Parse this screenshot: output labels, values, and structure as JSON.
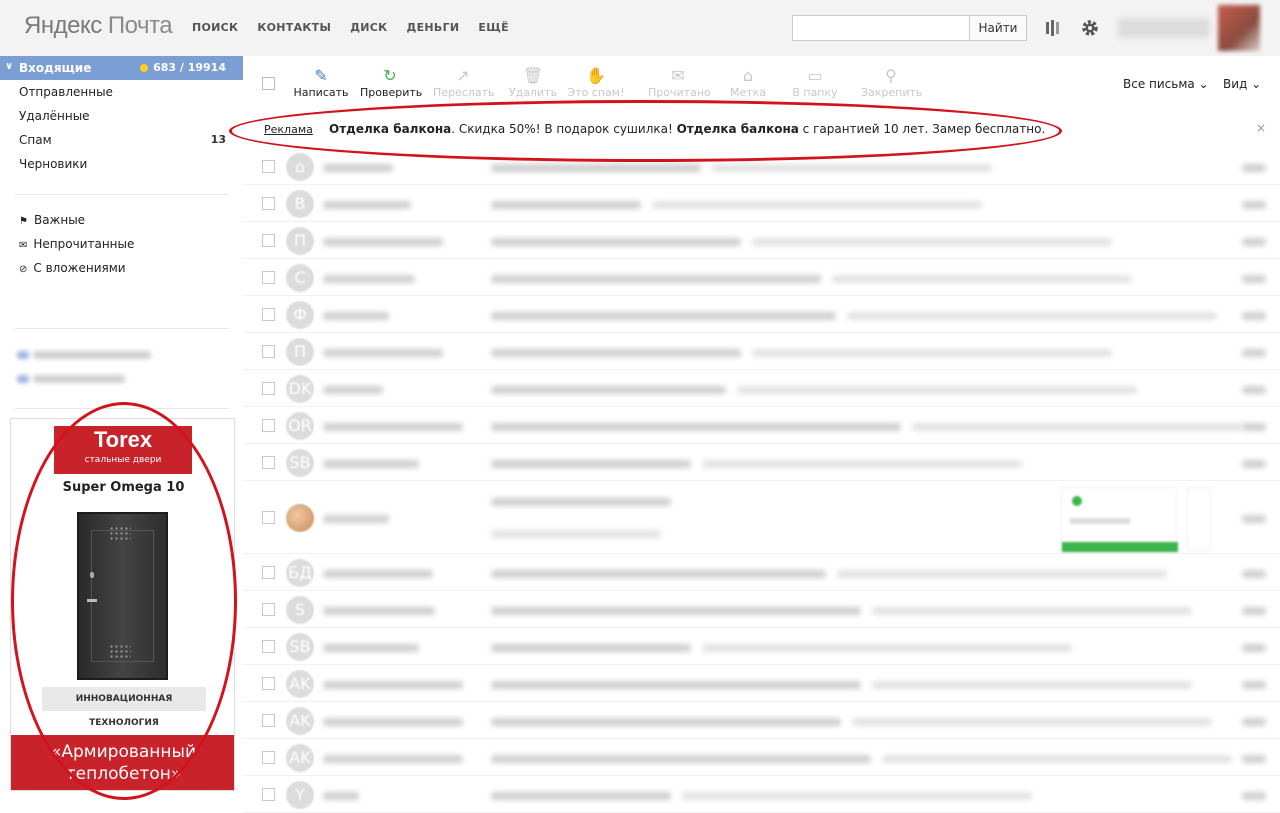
{
  "header": {
    "logo_yandex": "Яндекс",
    "logo_mail": "Почта",
    "nav": [
      "ПОИСК",
      "КОНТАКТЫ",
      "ДИСК",
      "ДЕНЬГИ",
      "ЕЩЁ"
    ],
    "search_button": "Найти"
  },
  "sidebar": {
    "inbox_label": "Входящие",
    "inbox_count": "683 / 19914",
    "folders": [
      {
        "label": "Отправленные",
        "count": ""
      },
      {
        "label": "Удалённые",
        "count": ""
      },
      {
        "label": "Спам",
        "count": "13"
      },
      {
        "label": "Черновики",
        "count": ""
      }
    ],
    "filters": [
      "Важные",
      "Непрочитанные",
      "С вложениями"
    ]
  },
  "side_ad": {
    "brand": "Torex",
    "brand_sub": "стальные двери",
    "model": "Super Omega 10",
    "tagline": "ИННОВАЦИОННАЯ ТЕХНОЛОГИЯ",
    "bottom_line1": "«Армированный",
    "bottom_line2": "теплобетон»"
  },
  "toolbar": {
    "buttons": [
      "Написать",
      "Проверить",
      "Переслать",
      "Удалить",
      "Это спам!",
      "Прочитано",
      "Метка",
      "В папку",
      "Закрепить"
    ],
    "all_mail": "Все письма",
    "view": "Вид"
  },
  "ad_banner": {
    "label": "Реклама",
    "bold1": "Отделка балкона",
    "text1": ". Скидка 50%! В подарок сушилка! ",
    "bold2": "Отделка балкона",
    "text2": " с гарантией 10 лет. Замер бесплатно.",
    "close": "×"
  },
  "mail_rows": [
    {
      "letter": "⌂"
    },
    {
      "letter": "В"
    },
    {
      "letter": "П"
    },
    {
      "letter": "С"
    },
    {
      "letter": "Ф"
    },
    {
      "letter": "П"
    },
    {
      "letter": "DK"
    },
    {
      "letter": "OR"
    },
    {
      "letter": "SB"
    },
    {
      "letter": ""
    },
    {
      "letter": "БД"
    },
    {
      "letter": "S"
    },
    {
      "letter": "SB"
    },
    {
      "letter": "AK"
    },
    {
      "letter": "AK"
    },
    {
      "letter": "AK"
    },
    {
      "letter": "Y"
    }
  ],
  "colors": {
    "active_folder": "#7b9ed4",
    "unread_dot": "#ffd21f",
    "annotation_red": "#d3131c",
    "torex_red": "#c8232a"
  }
}
